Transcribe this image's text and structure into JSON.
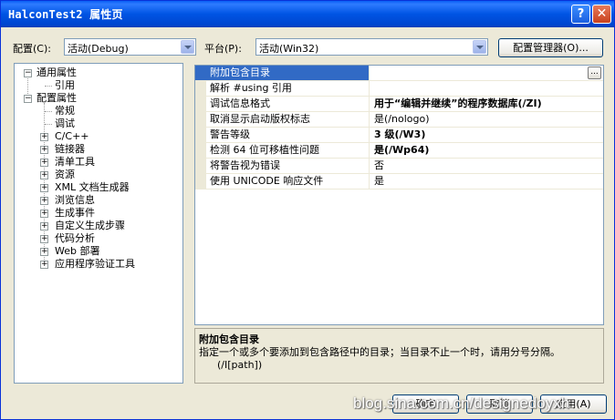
{
  "window": {
    "title": "HalconTest2 属性页"
  },
  "titlebar": {
    "help_label": "?",
    "close_label": "✕"
  },
  "config": {
    "label": "配置(C):",
    "value": "活动(Debug)"
  },
  "platform": {
    "label": "平台(P):",
    "value": "活动(Win32)"
  },
  "config_manager": {
    "label": "配置管理器(O)..."
  },
  "tree": {
    "general": "通用属性",
    "references": "引用",
    "config_props": "配置属性",
    "general_sub": "常规",
    "debugging": "调试",
    "items": [
      "C/C++",
      "链接器",
      "清单工具",
      "资源",
      "XML 文档生成器",
      "浏览信息",
      "生成事件",
      "自定义生成步骤",
      "代码分析",
      "Web 部署",
      "应用程序验证工具"
    ]
  },
  "grid": {
    "rows": [
      {
        "name": "附加包含目录",
        "value": ""
      },
      {
        "name": "解析 #using 引用",
        "value": ""
      },
      {
        "name": "调试信息格式",
        "value": "用于“编辑并继续”的程序数据库(/ZI)"
      },
      {
        "name": "取消显示启动版权标志",
        "value": "是(/nologo)"
      },
      {
        "name": "警告等级",
        "value": "3 级(/W3)"
      },
      {
        "name": "检测 64 位可移植性问题",
        "value": "是(/Wp64)"
      },
      {
        "name": "将警告视为错误",
        "value": "否"
      },
      {
        "name": "使用 UNICODE 响应文件",
        "value": "是"
      }
    ],
    "ellipsis": "..."
  },
  "description": {
    "title": "附加包含目录",
    "text": "指定一个或多个要添加到包含路径中的目录；当目录不止一个时，请用分号分隔。",
    "switch": "(/I[path])"
  },
  "buttons": {
    "ok": "确定",
    "cancel": "取消",
    "apply": "应用(A)"
  },
  "watermark": "blog.sina.com.cn/designedoyxh",
  "colors": {
    "selection": "#316AC5",
    "titlebar": "#0054E3",
    "dialog_bg": "#ECE9D8"
  }
}
